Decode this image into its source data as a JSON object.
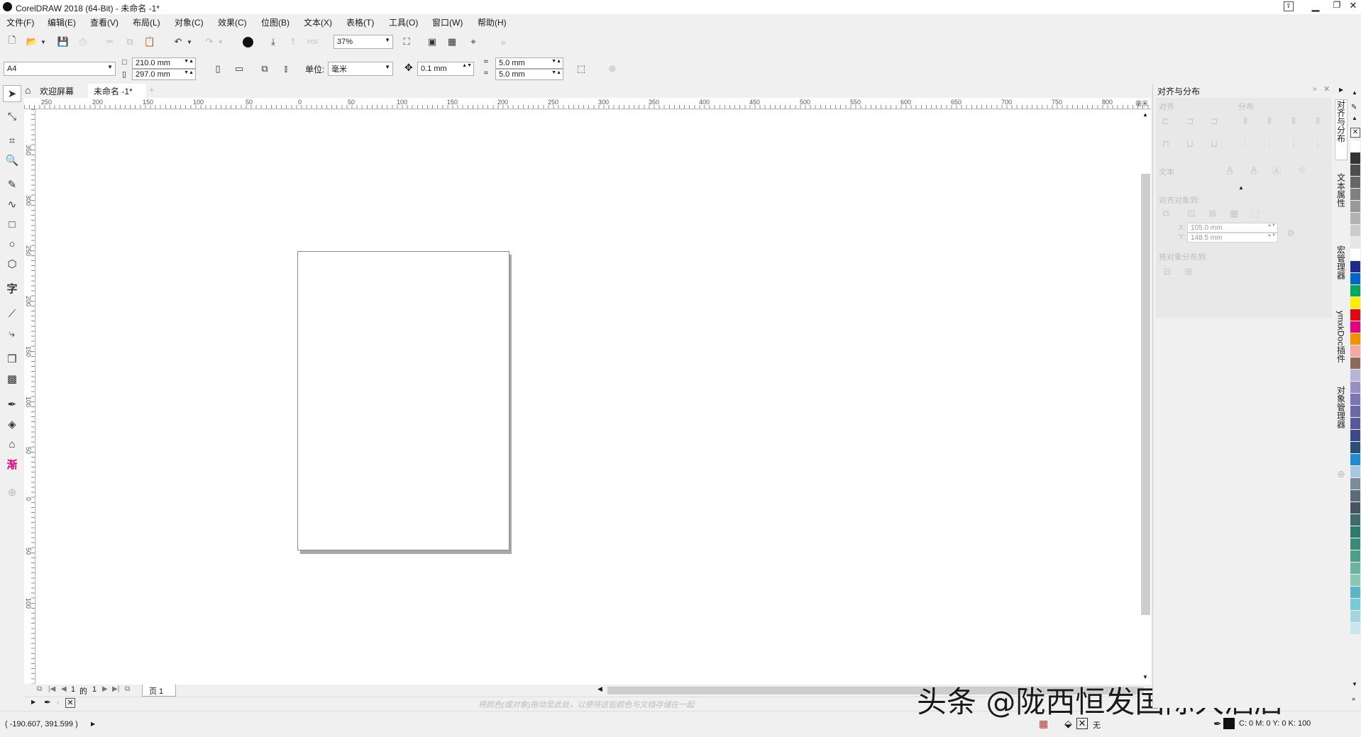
{
  "window": {
    "title": "CorelDRAW 2018 (64-Bit) - 未命名 -1*"
  },
  "menu": [
    "文件(F)",
    "编辑(E)",
    "查看(V)",
    "布局(L)",
    "对象(C)",
    "效果(C)",
    "位图(B)",
    "文本(X)",
    "表格(T)",
    "工具(O)",
    "窗口(W)",
    "帮助(H)"
  ],
  "toolbar": {
    "zoom": "37%"
  },
  "property_bar": {
    "page_size": "A4",
    "width": "210.0 mm",
    "height": "297.0 mm",
    "unit_label": "单位:",
    "unit_value": "毫米",
    "nudge": "0.1 mm",
    "dup_x": "5.0 mm",
    "dup_y": "5.0 mm"
  },
  "tabs": {
    "welcome": "欢迎屏幕",
    "document": "未命名 -1*"
  },
  "ruler": {
    "h_labels": [
      "250",
      "200",
      "150",
      "100",
      "50",
      "0",
      "50",
      "100",
      "150",
      "200",
      "250",
      "300",
      "350",
      "400",
      "450",
      "500",
      "550",
      "600",
      "650",
      "700",
      "750",
      "800"
    ],
    "h_unit": "毫米",
    "v_labels": [
      "350",
      "300",
      "250",
      "200",
      "150",
      "100",
      "50",
      "0",
      "50",
      "100"
    ]
  },
  "docker": {
    "title": "对齐与分布",
    "align_label": "对齐",
    "distribute_label": "分布",
    "text_label": "文本",
    "align_to_label": "对齐对象到:",
    "x_label": "X:",
    "x_value": "105.0 mm",
    "y_label": "Y:",
    "y_value": "148.5 mm",
    "distribute_to_label": "将对象分布到:"
  },
  "docker_tabs": [
    "对齐与分布",
    "文本属性",
    "宏管理器",
    "ymxkDoc插件",
    "对象管理器"
  ],
  "page_nav": {
    "current": "1",
    "of": "的",
    "total": "1",
    "page_tab": "页 1"
  },
  "color_hint": "将颜色(或对象)拖动至此处，以便将这些颜色与文档存储在一起",
  "status": {
    "coords": "( -190.607, 391.599 )",
    "fill_none": "无",
    "outline": "C: 0 M: 0 Y: 0 K: 100"
  },
  "watermark": "头条 @陇西恒发国际大酒店",
  "palette": [
    "#ffffff",
    "#333333",
    "#4d4d4d",
    "#666666",
    "#808080",
    "#999999",
    "#b3b3b3",
    "#cccccc",
    "#e6e6e6",
    "#ffffff",
    "#1f2a8c",
    "#0066cc",
    "#00a859",
    "#ffed00",
    "#e30613",
    "#e6007e",
    "#f39200",
    "#f7a6a0",
    "#8c6b5e",
    "#b5b5d9",
    "#9b8ec4",
    "#7d74b5",
    "#6a6aa8",
    "#56599c",
    "#3b4a8a",
    "#2b4f7a",
    "#1f8bd1",
    "#a8c8e0",
    "#7a8c99",
    "#5c6b75",
    "#465561",
    "#3b6b6b",
    "#2e7a6b",
    "#3a8a7a",
    "#4c9e8a",
    "#6bb5a0",
    "#8ac7b5",
    "#5ab5c7",
    "#7acad6",
    "#a0d6de",
    "#c6e8ea"
  ]
}
